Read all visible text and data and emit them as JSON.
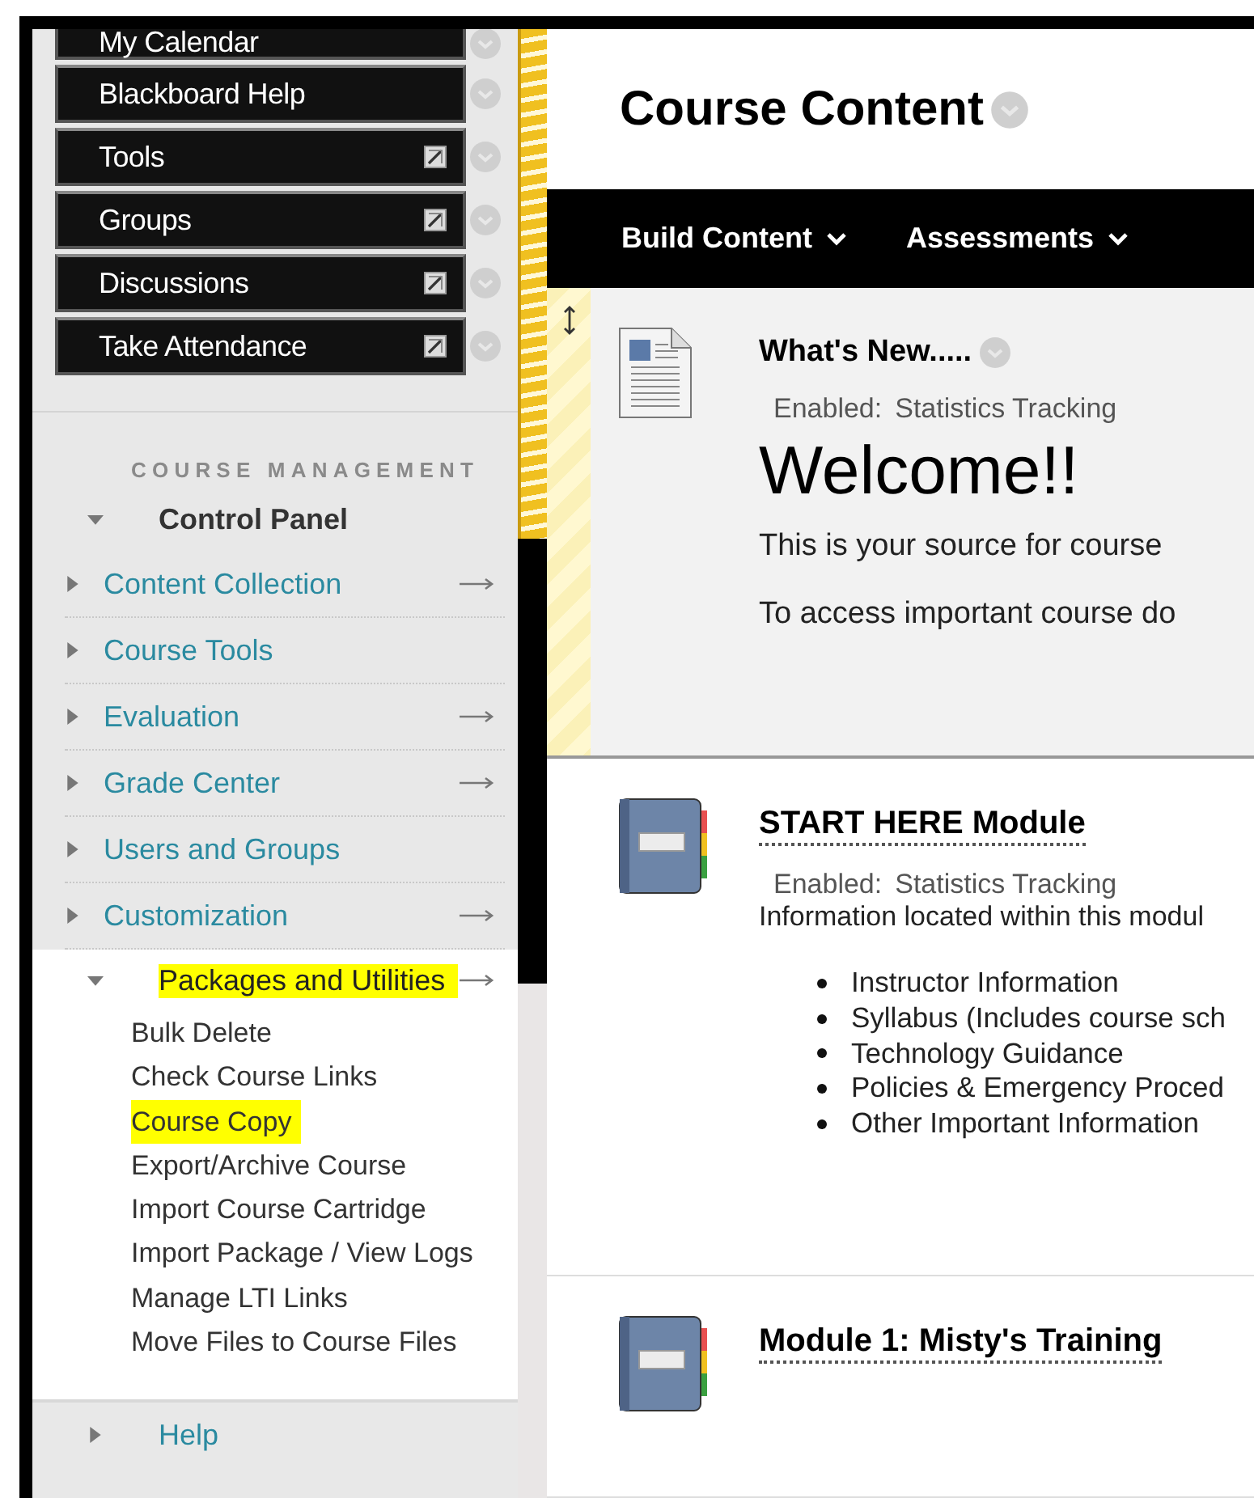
{
  "course_menu": [
    {
      "label": "My Calendar",
      "editable": false
    },
    {
      "label": "Blackboard Help",
      "editable": false
    },
    {
      "label": "Tools",
      "editable": true
    },
    {
      "label": "Groups",
      "editable": true
    },
    {
      "label": "Discussions",
      "editable": true
    },
    {
      "label": "Take Attendance",
      "editable": true
    }
  ],
  "course_management": {
    "heading": "COURSE MANAGEMENT",
    "control_panel": {
      "label": "Control Panel",
      "expanded": true
    },
    "items": [
      {
        "label": "Content Collection",
        "expanded": false,
        "has_arrow": true,
        "highlighted": false
      },
      {
        "label": "Course Tools",
        "expanded": false,
        "has_arrow": false,
        "highlighted": false
      },
      {
        "label": "Evaluation",
        "expanded": false,
        "has_arrow": true,
        "highlighted": false
      },
      {
        "label": "Grade Center",
        "expanded": false,
        "has_arrow": true,
        "highlighted": false
      },
      {
        "label": "Users and Groups",
        "expanded": false,
        "has_arrow": false,
        "highlighted": false
      },
      {
        "label": "Customization",
        "expanded": false,
        "has_arrow": true,
        "highlighted": false
      },
      {
        "label": "Packages and Utilities",
        "expanded": true,
        "has_arrow": true,
        "highlighted": true,
        "children": [
          {
            "label": "Bulk Delete",
            "highlighted": false
          },
          {
            "label": "Check Course Links",
            "highlighted": false
          },
          {
            "label": "Course Copy",
            "highlighted": true
          },
          {
            "label": "Export/Archive Course",
            "highlighted": false
          },
          {
            "label": "Import Course Cartridge",
            "highlighted": false
          },
          {
            "label": "Import Package / View Logs",
            "highlighted": false
          },
          {
            "label": "Manage LTI Links",
            "highlighted": false
          },
          {
            "label": "Move Files to Course Files",
            "highlighted": false
          }
        ]
      },
      {
        "label": "Help",
        "expanded": false,
        "has_arrow": false,
        "highlighted": false
      }
    ]
  },
  "page_title": "Course Content",
  "toolbar": [
    {
      "label": "Build Content"
    },
    {
      "label": "Assessments"
    }
  ],
  "content_items": [
    {
      "kind": "document",
      "selected": true,
      "title": "What's New.....",
      "enabled_label": "Enabled:",
      "enabled_value": "Statistics Tracking",
      "body": [
        {
          "kind": "heading",
          "text": "Welcome!!"
        },
        {
          "kind": "paragraph",
          "text": "This is your source for course"
        },
        {
          "kind": "paragraph",
          "text": "To access important course do"
        }
      ]
    },
    {
      "kind": "module",
      "selected": false,
      "title": "START HERE Module",
      "enabled_label": "Enabled:",
      "enabled_value": "Statistics Tracking",
      "body": [
        {
          "kind": "note",
          "text": "Information located within this modul"
        },
        {
          "kind": "bullets",
          "items": [
            "Instructor Information",
            "Syllabus (Includes course sch",
            "Technology Guidance",
            "Policies & Emergency Proced",
            "Other Important Information"
          ]
        }
      ]
    },
    {
      "kind": "module",
      "selected": false,
      "title": "Module 1: Misty's Training"
    }
  ]
}
